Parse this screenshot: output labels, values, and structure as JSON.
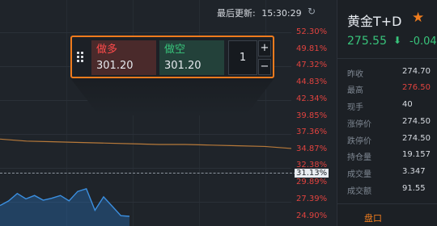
{
  "header": {
    "last_update_label": "最后更新:",
    "last_update_time": "15:30:29",
    "refresh_icon": "refresh-icon"
  },
  "trade_box": {
    "buy_label": "做多",
    "buy_price": "301.20",
    "sell_label": "做空",
    "sell_price": "301.20",
    "quantity": "1",
    "plus": "+",
    "minus": "−"
  },
  "y_axis": {
    "labels": [
      "52.30%",
      "49.81%",
      "47.32%",
      "44.83%",
      "42.34%",
      "39.85%",
      "37.36%",
      "34.87%",
      "32.38%",
      "29.89%",
      "27.39%",
      "24.90%"
    ],
    "current": "31.13%"
  },
  "chart_data": {
    "type": "line",
    "series": [
      {
        "values": [
          36.4,
          36.1,
          36.0,
          35.9,
          35.8,
          35.7,
          35.6,
          35.6,
          35.5,
          35.4,
          35.3,
          35.0
        ]
      },
      {
        "values": [
          26.5,
          27.2,
          28.3,
          27.5,
          28.0,
          27.3,
          27.6,
          28.0,
          27.2,
          28.6,
          29.0,
          25.8,
          27.8,
          26.4,
          25.0,
          24.9
        ]
      }
    ],
    "current_value": 31.13,
    "ylim": [
      24.9,
      52.3
    ]
  },
  "panel": {
    "symbol": "黄金T+D",
    "last_price": "275.55",
    "change": "-0.04",
    "stats": [
      {
        "k": "昨收",
        "v": "274.70",
        "red": false
      },
      {
        "k": "最高",
        "v": "276.50",
        "red": true
      },
      {
        "k": "现手",
        "v": "40",
        "red": false
      },
      {
        "k": "涨停价",
        "v": "274.50",
        "red": false
      },
      {
        "k": "跌停价",
        "v": "274.50",
        "red": false
      },
      {
        "k": "持仓量",
        "v": "19.157",
        "red": false
      },
      {
        "k": "成交量",
        "v": "3.347",
        "red": false
      },
      {
        "k": "成交额",
        "v": "91.55",
        "red": false
      }
    ],
    "bottom_tab": "盘口"
  }
}
